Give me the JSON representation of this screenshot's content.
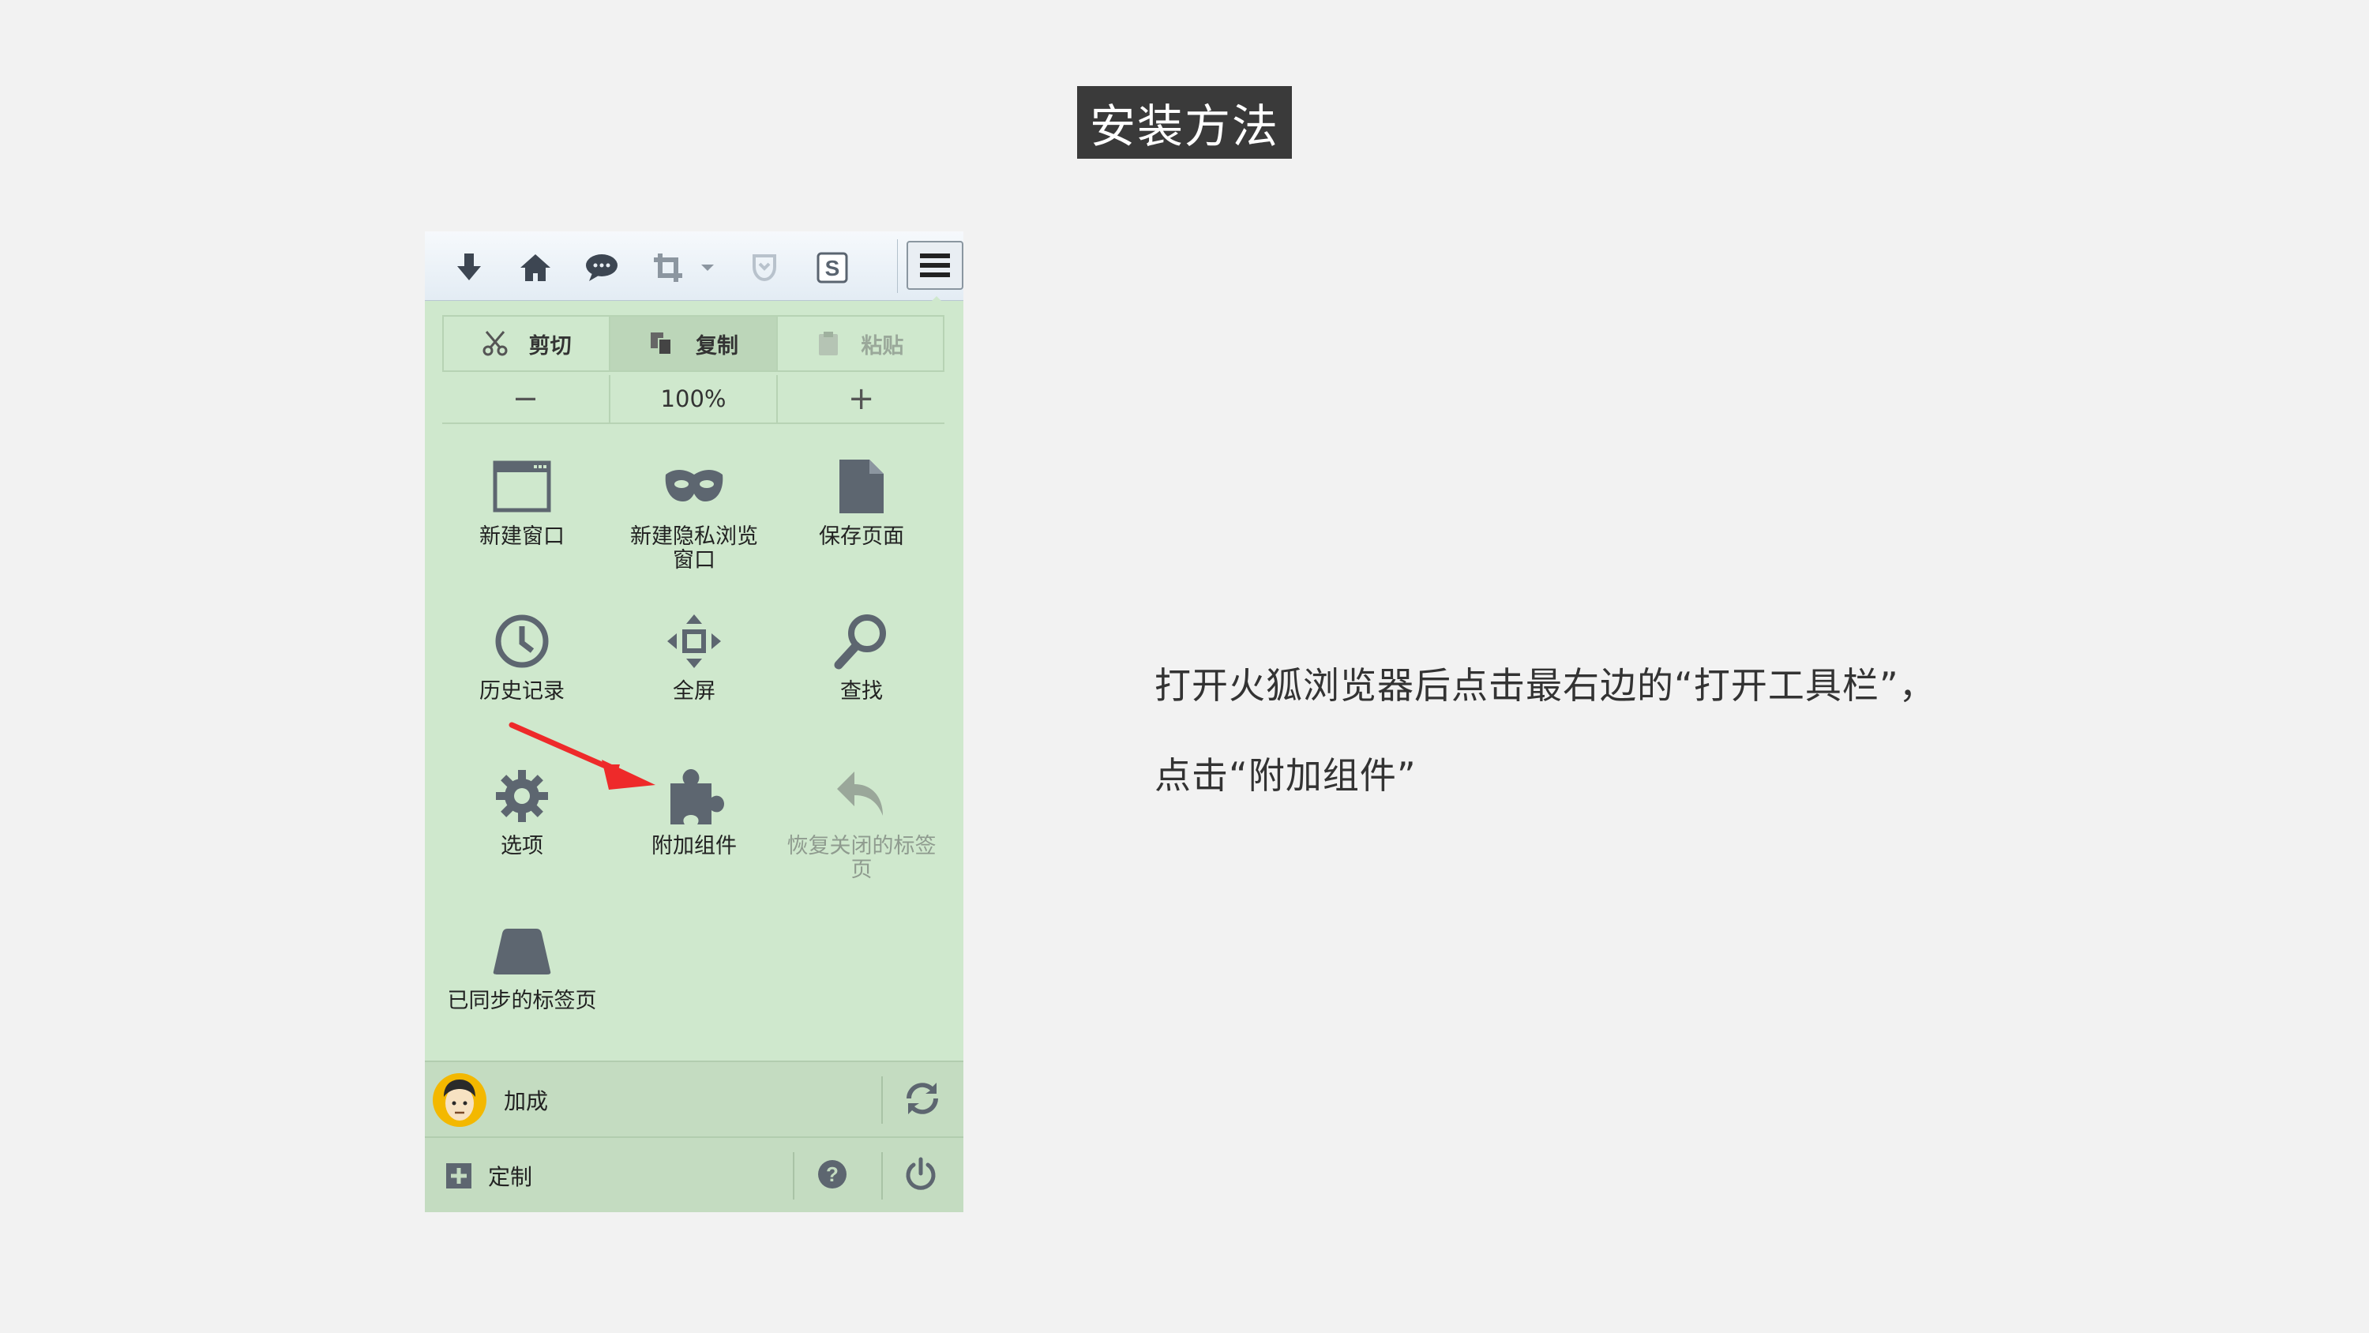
{
  "slide": {
    "title": "安装方法",
    "description_line1": "打开火狐浏览器后点击最右边的“打开工具栏”，",
    "description_line2": "点击“附加组件”"
  },
  "toolbar": {
    "buttons": [
      "download-icon",
      "home-icon",
      "chat-icon",
      "crop-icon",
      "dropdown-icon",
      "pocket-icon",
      "s-icon",
      "hamburger-menu-icon"
    ]
  },
  "edit_controls": {
    "cut": "剪切",
    "copy": "复制",
    "paste": "粘贴"
  },
  "zoom_controls": {
    "minus": "−",
    "level": "100%",
    "plus": "+"
  },
  "menu_items": [
    {
      "label": "新建窗口",
      "icon": "window-icon"
    },
    {
      "label": "新建隐私浏览窗口",
      "icon": "mask-icon"
    },
    {
      "label": "保存页面",
      "icon": "page-icon"
    },
    {
      "label": "历史记录",
      "icon": "clock-icon"
    },
    {
      "label": "全屏",
      "icon": "fullscreen-icon"
    },
    {
      "label": "查找",
      "icon": "magnifier-icon"
    },
    {
      "label": "选项",
      "icon": "gear-icon"
    },
    {
      "label": "附加组件",
      "icon": "puzzle-icon"
    },
    {
      "label": "恢复关闭的标签页",
      "icon": "undo-arrow-icon"
    },
    {
      "label": "已同步的标签页",
      "icon": "synced-tabs-icon"
    }
  ],
  "account": {
    "name": "加成"
  },
  "footer": {
    "customize": "定制"
  },
  "colors": {
    "panel_bg": "#cfe8cd",
    "title_bg": "#3a3a3a",
    "arrow": "#ee2a2a"
  }
}
